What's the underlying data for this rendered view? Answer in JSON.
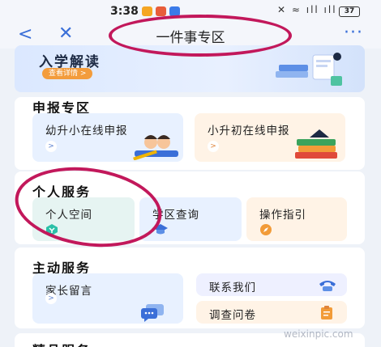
{
  "status_bar": {
    "time": "3:38",
    "system_icons_text": "✕ ≈ ıll ıll",
    "battery": "37"
  },
  "nav": {
    "back_glyph": "<",
    "close_glyph": "✕",
    "title": "一件事专区",
    "more_glyph": "···"
  },
  "banner": {
    "title": "入学解读",
    "button": "查看详情 >"
  },
  "apply_section": {
    "title": "申报专区",
    "tiles": [
      {
        "label": "幼升小在线申报",
        "arrow": ">"
      },
      {
        "label": "小升初在线申报",
        "arrow": ">"
      }
    ]
  },
  "personal_section": {
    "title": "个人服务",
    "tiles": [
      {
        "label": "个人空间"
      },
      {
        "label": "学区查询"
      },
      {
        "label": "操作指引"
      }
    ]
  },
  "active_section": {
    "title": "主动服务",
    "tiles": [
      {
        "label": "家长留言",
        "arrow": ">"
      },
      {
        "label": "联系我们"
      },
      {
        "label": "调查问卷"
      }
    ]
  },
  "bottom_section": {
    "title": "精品服务"
  },
  "watermark": "weixinpic.com",
  "colors": {
    "accent_blue": "#3a6fd8",
    "banner_button": "#f39c3c",
    "highlight": "#c2185b",
    "tile_blue": "#e8f1ff",
    "tile_orange": "#fff3e6",
    "tile_lavender": "#eef0ff"
  }
}
